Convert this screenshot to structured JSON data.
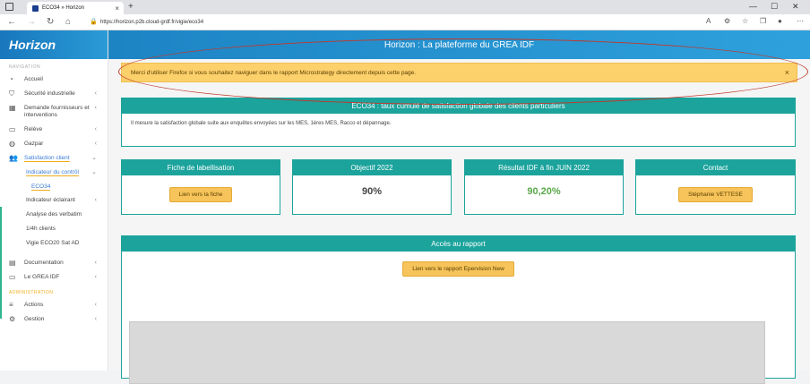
{
  "browser": {
    "tab_title": "ECO34 » Horizon",
    "tab_close": "×",
    "new_tab": "+",
    "url": "https://horizon.p2b.cloud-grdf.fr/vigie/eco34",
    "window_controls": [
      "—",
      "☐",
      "✕"
    ]
  },
  "app": {
    "logo": "Horizon",
    "header_title": "Horizon : La plateforme du GREA IDF"
  },
  "sidebar": {
    "nav_heading": "NAVIGATION",
    "items": [
      {
        "label": "Accueil",
        "icon": "gauge-icon"
      },
      {
        "label": "Sécurité industrielle",
        "icon": "shield-icon"
      },
      {
        "label": "Demande fournisseurs et interventions",
        "icon": "chart-icon"
      },
      {
        "label": "Relève",
        "icon": "meter-icon"
      },
      {
        "label": "Gazpar",
        "icon": "globe-icon"
      },
      {
        "label": "Satisfaction client",
        "icon": "users-icon"
      }
    ],
    "sub_items": {
      "indicateur_controle": "Indicateur du contrôl",
      "eco34": "ECO34",
      "indicateur_eclairant": "Indicateur éclairant",
      "analyse_verbatim": "Analyse des verbatim",
      "quart_heure": "1/4h clients",
      "vigie_eco20": "Vigie ECO20 Sat AD"
    },
    "lower_items": [
      {
        "label": "Documentation",
        "icon": "doc-icon"
      },
      {
        "label": "Le GREA IDF",
        "icon": "window-icon"
      }
    ],
    "admin_heading": "ADMINISTRATION",
    "admin_items": [
      {
        "label": "Actions",
        "icon": "list-icon"
      },
      {
        "label": "Gestion",
        "icon": "gear-icon"
      }
    ]
  },
  "alert": {
    "text": "Merci d'utiliser Firefox si vous souhaitez naviguer dans le rapport Microstrategy directement depuis cette page.",
    "close": "×"
  },
  "eco34_card": {
    "title": "ECO34 : taux cumulé de satisfaction globale des clients particuliers",
    "description": "Il mesure la satisfaction globale suite aux enquêtes envoyées sur les MES, 1ères MES, Racco et dépannage."
  },
  "cards": {
    "labellisation": {
      "title": "Fiche de labellisation",
      "button": "Lien vers la fiche"
    },
    "objectif": {
      "title": "Objectif 2022",
      "value": "90%"
    },
    "resultat": {
      "title": "Résultat IDF à fin JUIN 2022",
      "value": "90,20%",
      "color": "#5aa84a"
    },
    "contact": {
      "title": "Contact",
      "button": "Stéphanie VETTESE"
    }
  },
  "acces": {
    "title": "Accès au rapport",
    "button": "Lien vers le rapport Epervision New"
  },
  "colors": {
    "teal": "#1ba39c",
    "header_blue": "#1d84c4",
    "alert_yellow": "#fcd06b",
    "button_yellow": "#f6c45a"
  }
}
